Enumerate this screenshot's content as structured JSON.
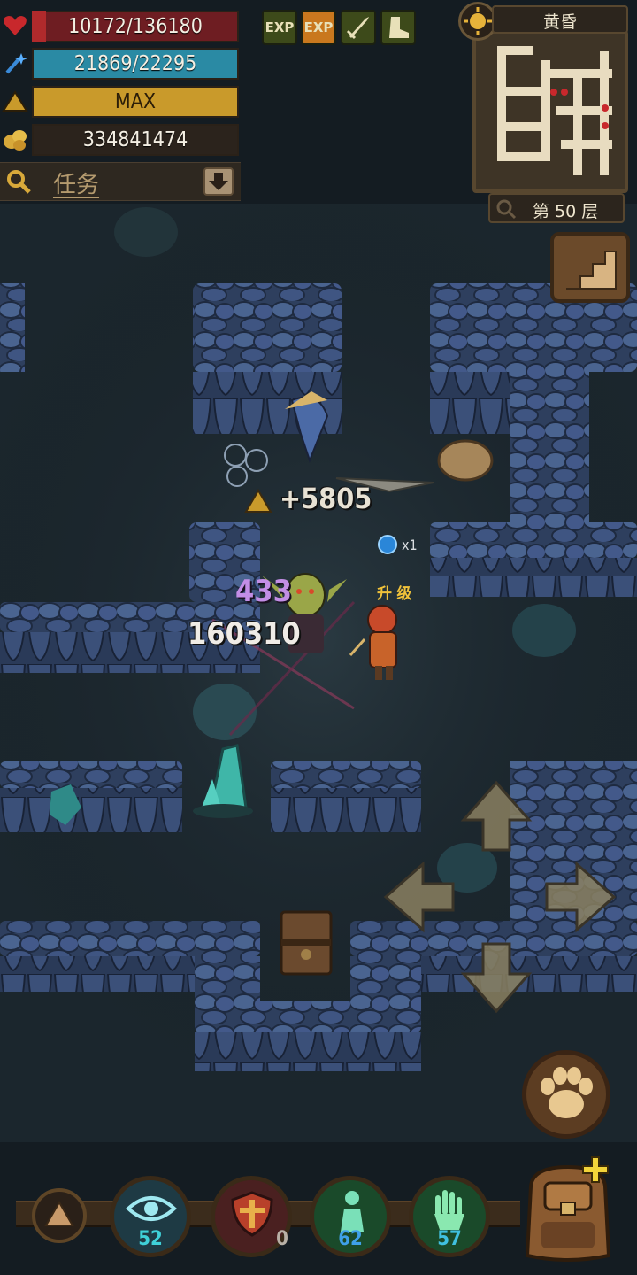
{
  "hud": {
    "hp": "10172/136180",
    "mp": "21869/22295",
    "level": "MAX",
    "gold": "334841474",
    "task_label": "任务"
  },
  "buffs": [
    {
      "label": "EXP",
      "active": false
    },
    {
      "label": "EXP",
      "active": true
    },
    {
      "icon": "sword-boost-icon"
    },
    {
      "icon": "boot-boost-icon"
    }
  ],
  "minimap": {
    "time_of_day": "黄昏",
    "floor": "第 50 层"
  },
  "combat": {
    "exp_gain": "+5805",
    "damage_small": "433",
    "damage_big": "160310",
    "orb_count": "x1",
    "level_up": "升 级"
  },
  "skills": [
    {
      "icon": "eye-skill-icon",
      "count": "52",
      "color": "#3fd0d8"
    },
    {
      "icon": "shield-skill-icon",
      "count": "0",
      "color": "#b8b0a6"
    },
    {
      "icon": "figure-skill-icon",
      "count": "62",
      "color": "#3fa0e8"
    },
    {
      "icon": "hand-skill-icon",
      "count": "57",
      "color": "#40c0e0"
    }
  ],
  "colors": {
    "hp": "#6e1d22",
    "mp": "#2a8aa4",
    "level": "#c99a2b",
    "wall": "#3a4e72"
  }
}
